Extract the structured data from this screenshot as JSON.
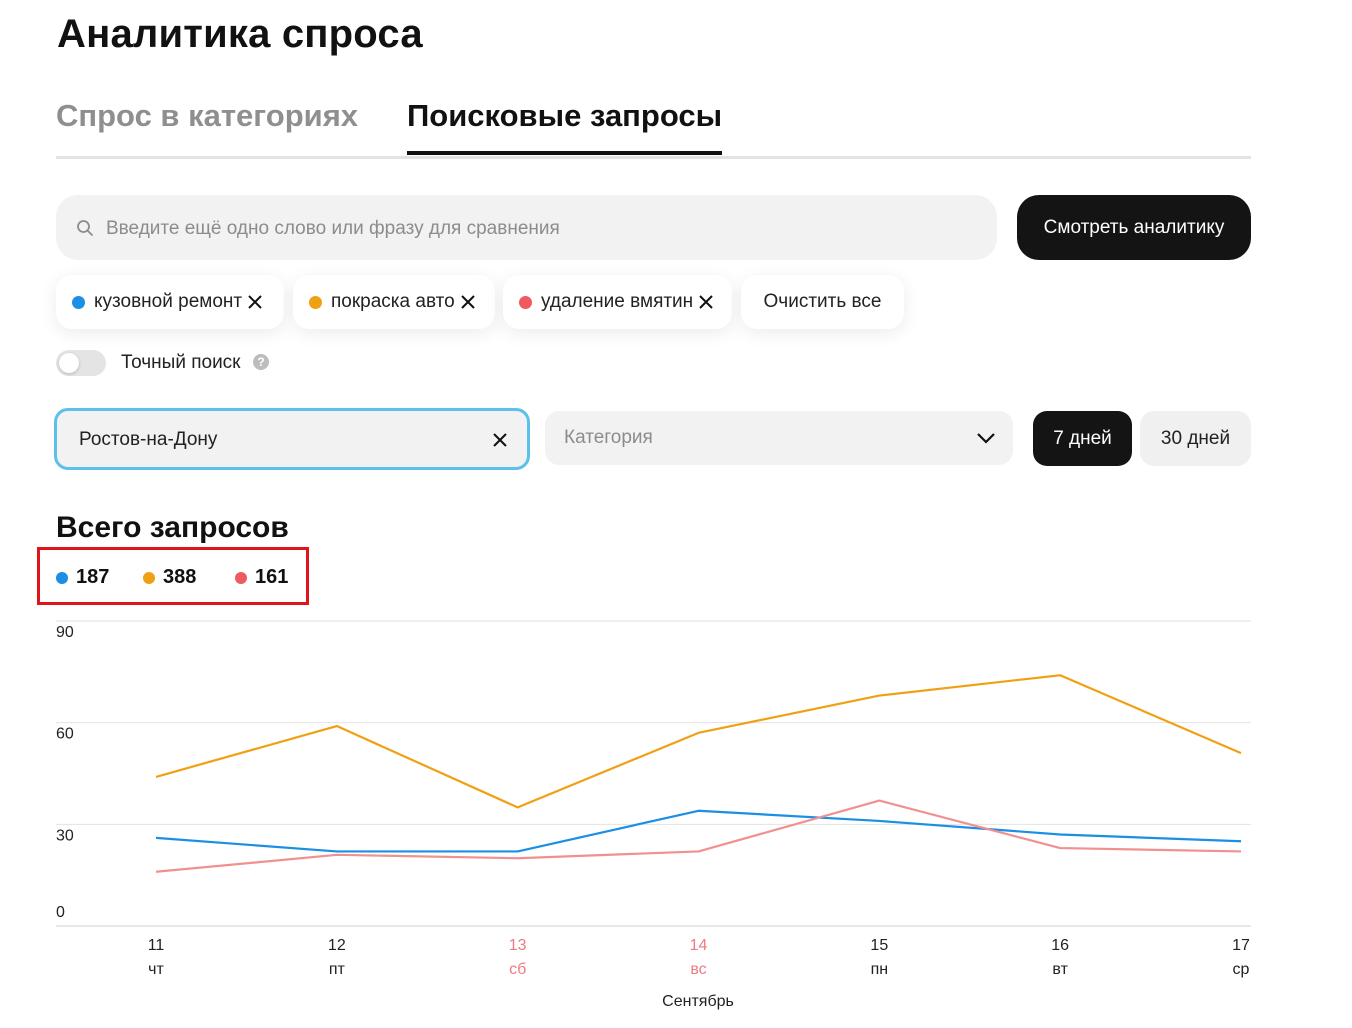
{
  "page": {
    "title": "Аналитика спроса"
  },
  "tabs": [
    {
      "label": "Спрос в категориях",
      "active": false
    },
    {
      "label": "Поисковые запросы",
      "active": true
    }
  ],
  "search": {
    "placeholder": "Введите ещё одно слово или фразу для сравнения",
    "value": "",
    "icon": "search-icon",
    "submit_label": "Смотреть аналитику"
  },
  "chips": [
    {
      "label": "кузовной ремонт",
      "color": "#1a8fe3"
    },
    {
      "label": "покраска авто",
      "color": "#f0a013"
    },
    {
      "label": "удаление вмятин",
      "color": "#f0595f"
    }
  ],
  "chips_clear_label": "Очистить все",
  "exact_search": {
    "label": "Точный поиск",
    "enabled": false,
    "help_glyph": "?"
  },
  "filters": {
    "city_value": "Ростов-на-Дону",
    "category_placeholder": "Категория",
    "periods": [
      {
        "label": "7 дней",
        "active": true
      },
      {
        "label": "30 дней",
        "active": false
      }
    ]
  },
  "totals": {
    "title": "Всего запросов",
    "items": [
      {
        "value": "187",
        "color": "#1a8fe3"
      },
      {
        "value": "388",
        "color": "#f0a013"
      },
      {
        "value": "161",
        "color": "#f0595f"
      }
    ]
  },
  "chart_data": {
    "type": "line",
    "x": [
      "11",
      "12",
      "13",
      "14",
      "15",
      "16",
      "17"
    ],
    "weekdays": [
      "чт",
      "пт",
      "сб",
      "вс",
      "пн",
      "вт",
      "ср"
    ],
    "weekend": [
      false,
      false,
      true,
      true,
      false,
      false,
      false
    ],
    "xlabel": "Сентябрь",
    "ylabel": "",
    "yticks": [
      0,
      30,
      60,
      90
    ],
    "ylim": [
      0,
      90
    ],
    "grid": true,
    "series": [
      {
        "color": "#1a8fe3",
        "values": [
          26,
          22,
          22,
          34,
          31,
          27,
          25
        ]
      },
      {
        "color": "#f0a013",
        "values": [
          44,
          59,
          35,
          57,
          68,
          74,
          51
        ]
      },
      {
        "color": "#f09090",
        "values": [
          16,
          21,
          20,
          22,
          37,
          23,
          22
        ]
      }
    ]
  }
}
